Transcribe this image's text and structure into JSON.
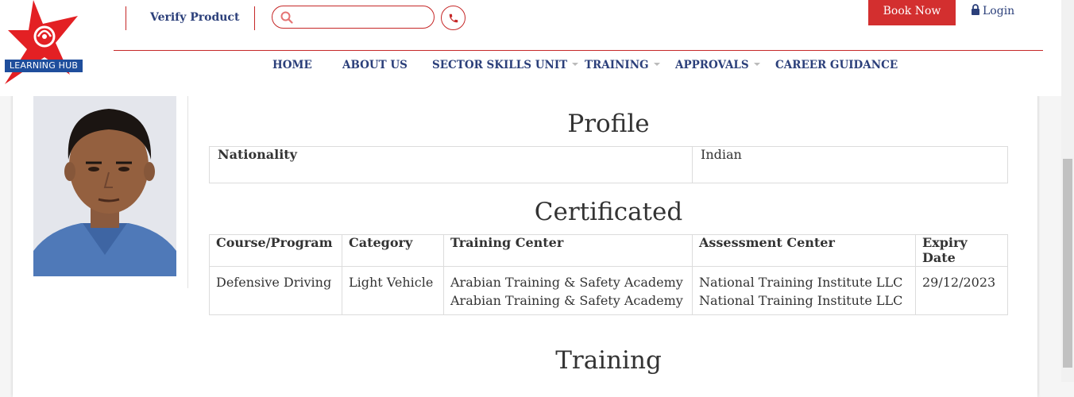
{
  "header": {
    "logo_text": "LEARNING HUB",
    "verify_label": "Verify Product",
    "search_placeholder": "",
    "book_now_label": "Book Now",
    "login_label": "Login"
  },
  "nav": {
    "items": [
      {
        "label": "HOME",
        "has_dropdown": false
      },
      {
        "label": "ABOUT US",
        "has_dropdown": false
      },
      {
        "label": "SECTOR SKILLS UNIT",
        "has_dropdown": true
      },
      {
        "label": "TRAINING",
        "has_dropdown": true
      },
      {
        "label": "APPROVALS",
        "has_dropdown": true
      },
      {
        "label": "CAREER GUIDANCE",
        "has_dropdown": false
      }
    ]
  },
  "profile": {
    "title": "Profile",
    "rows": [
      {
        "label": "Nationality",
        "value": "Indian"
      }
    ]
  },
  "certificated": {
    "title": "Certificated",
    "headers": [
      "Course/Program",
      "Category",
      "Training Center",
      "Assessment Center",
      "Expiry Date"
    ],
    "rows": [
      {
        "course": "Defensive Driving",
        "category": "Light Vehicle",
        "training_center_1": "Arabian Training & Safety Academy",
        "training_center_2": "Arabian Training & Safety Academy",
        "assessment_center_1": "National Training Institute LLC",
        "assessment_center_2": "National Training Institute LLC",
        "expiry": "29/12/2023"
      }
    ]
  },
  "training": {
    "title": "Training"
  },
  "colors": {
    "accent_red": "#d32f2f",
    "nav_blue": "#2b3f7a",
    "logo_blue": "#1f4e9c"
  },
  "icons": [
    "search-icon",
    "phone-icon",
    "lock-icon",
    "star-logo"
  ]
}
